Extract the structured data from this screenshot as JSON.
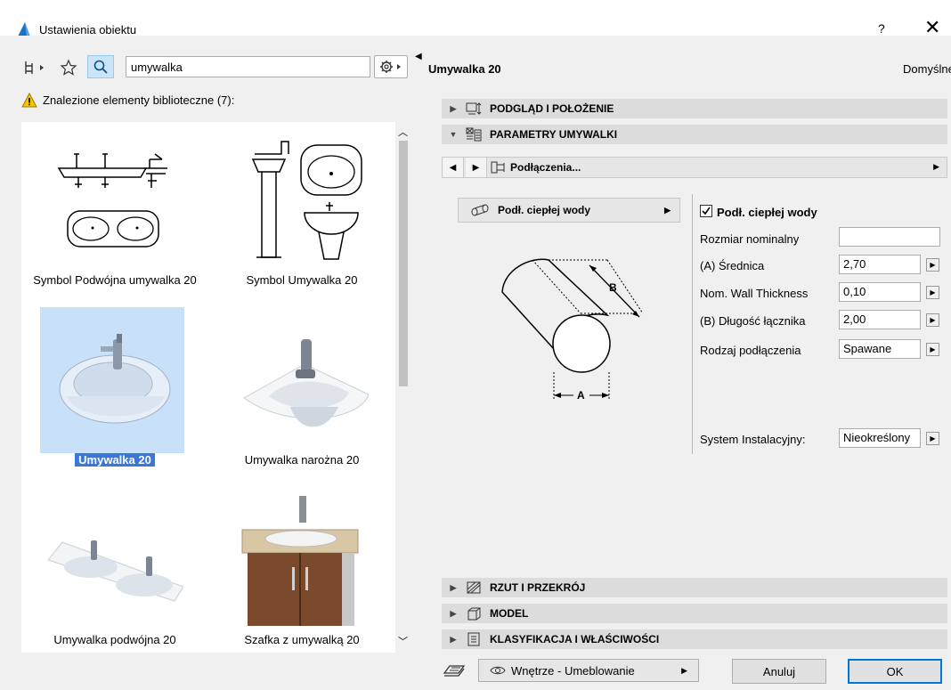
{
  "window": {
    "title": "Ustawienia obiektu",
    "help": "?",
    "close": "✕"
  },
  "search": {
    "value": "umywalka"
  },
  "library": {
    "found_label": "Znalezione elementy biblioteczne (7):",
    "items": [
      {
        "label": "Symbol Podwójna umywalka 20"
      },
      {
        "label": "Symbol Umywalka 20"
      },
      {
        "label": "Umywalka 20"
      },
      {
        "label": "Umywalka narożna 20"
      },
      {
        "label": "Umywalka podwójna 20"
      },
      {
        "label": "Szafka z umywalką 20"
      }
    ]
  },
  "object": {
    "name": "Umywalka 20",
    "default_label": "Domyślne"
  },
  "sections": {
    "preview": "PODGLĄD I POŁOŻENIE",
    "params": "PARAMETRY UMYWALKI",
    "plan": "RZUT I PRZEKRÓJ",
    "model": "MODEL",
    "classification": "KLASYFIKACJA I WŁAŚCIWOŚCI"
  },
  "nav": {
    "label": "Podłączenia..."
  },
  "subpanel": {
    "label": "Podł. ciepłej wody"
  },
  "diagram": {
    "label_a": "A",
    "label_b": "B"
  },
  "params": {
    "checkbox_label": "Podł. ciepłej wody",
    "rows": [
      {
        "label": "Rozmiar nominalny",
        "value": ""
      },
      {
        "label": "(A) Średnica",
        "value": "2,70"
      },
      {
        "label": "Nom. Wall Thickness",
        "value": "0,10"
      },
      {
        "label": "(B) Długość łącznika",
        "value": "2,00"
      },
      {
        "label": "Rodzaj podłączenia",
        "value": "Spawane"
      }
    ],
    "system_label": "System Instalacyjny:",
    "system_value": "Nieokreślony"
  },
  "footer": {
    "layer": "Wnętrze - Umeblowanie",
    "cancel": "Anuluj",
    "ok": "OK"
  }
}
